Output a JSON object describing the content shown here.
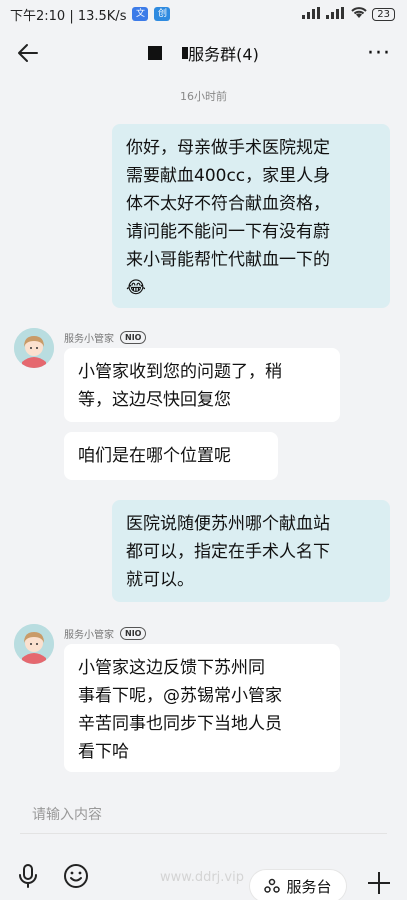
{
  "status_bar": {
    "time_speed": "下午2:10 | 13.5K/s",
    "app_icon_label": "文",
    "app_icon2_label": "创",
    "battery": "23"
  },
  "header": {
    "title": "服务群(4)",
    "more_label": "···"
  },
  "timestamp": "16小时前",
  "messages": [
    {
      "direction": "out",
      "lines": [
        "你好，母亲做手术医院规定",
        "需要献血400cc，家里人身",
        "体不太好不符合献血资格，",
        "请问能不能问一下有没有蔚",
        "来小哥能帮忙代献血一下的"
      ],
      "emoji": "😂"
    },
    {
      "direction": "in",
      "sender": "服务小管家",
      "sender_badge": "NIO",
      "lines": [
        "小管家收到您的问题了，稍",
        "等，这边尽快回复您"
      ]
    },
    {
      "direction": "in",
      "lines": [
        "咱们是在哪个位置呢"
      ]
    },
    {
      "direction": "out",
      "lines": [
        "医院说随便苏州哪个献血站",
        "都可以，指定在手术人名下",
        "就可以。"
      ]
    },
    {
      "direction": "in",
      "sender": "服务小管家",
      "sender_badge": "NIO",
      "lines": [
        "小管家这边反馈下苏州同",
        "事看下呢，@苏锡常小管家",
        "辛苦同事也同步下当地人员",
        "看下哈"
      ]
    }
  ],
  "input": {
    "placeholder": "请输入内容"
  },
  "toolbar": {
    "service_label": "服务台"
  },
  "watermark": "www.ddrj.vip",
  "colors": {
    "outgoing_bubble": "#dbeef2",
    "incoming_bubble": "#ffffff",
    "background": "#f2f3f5"
  }
}
